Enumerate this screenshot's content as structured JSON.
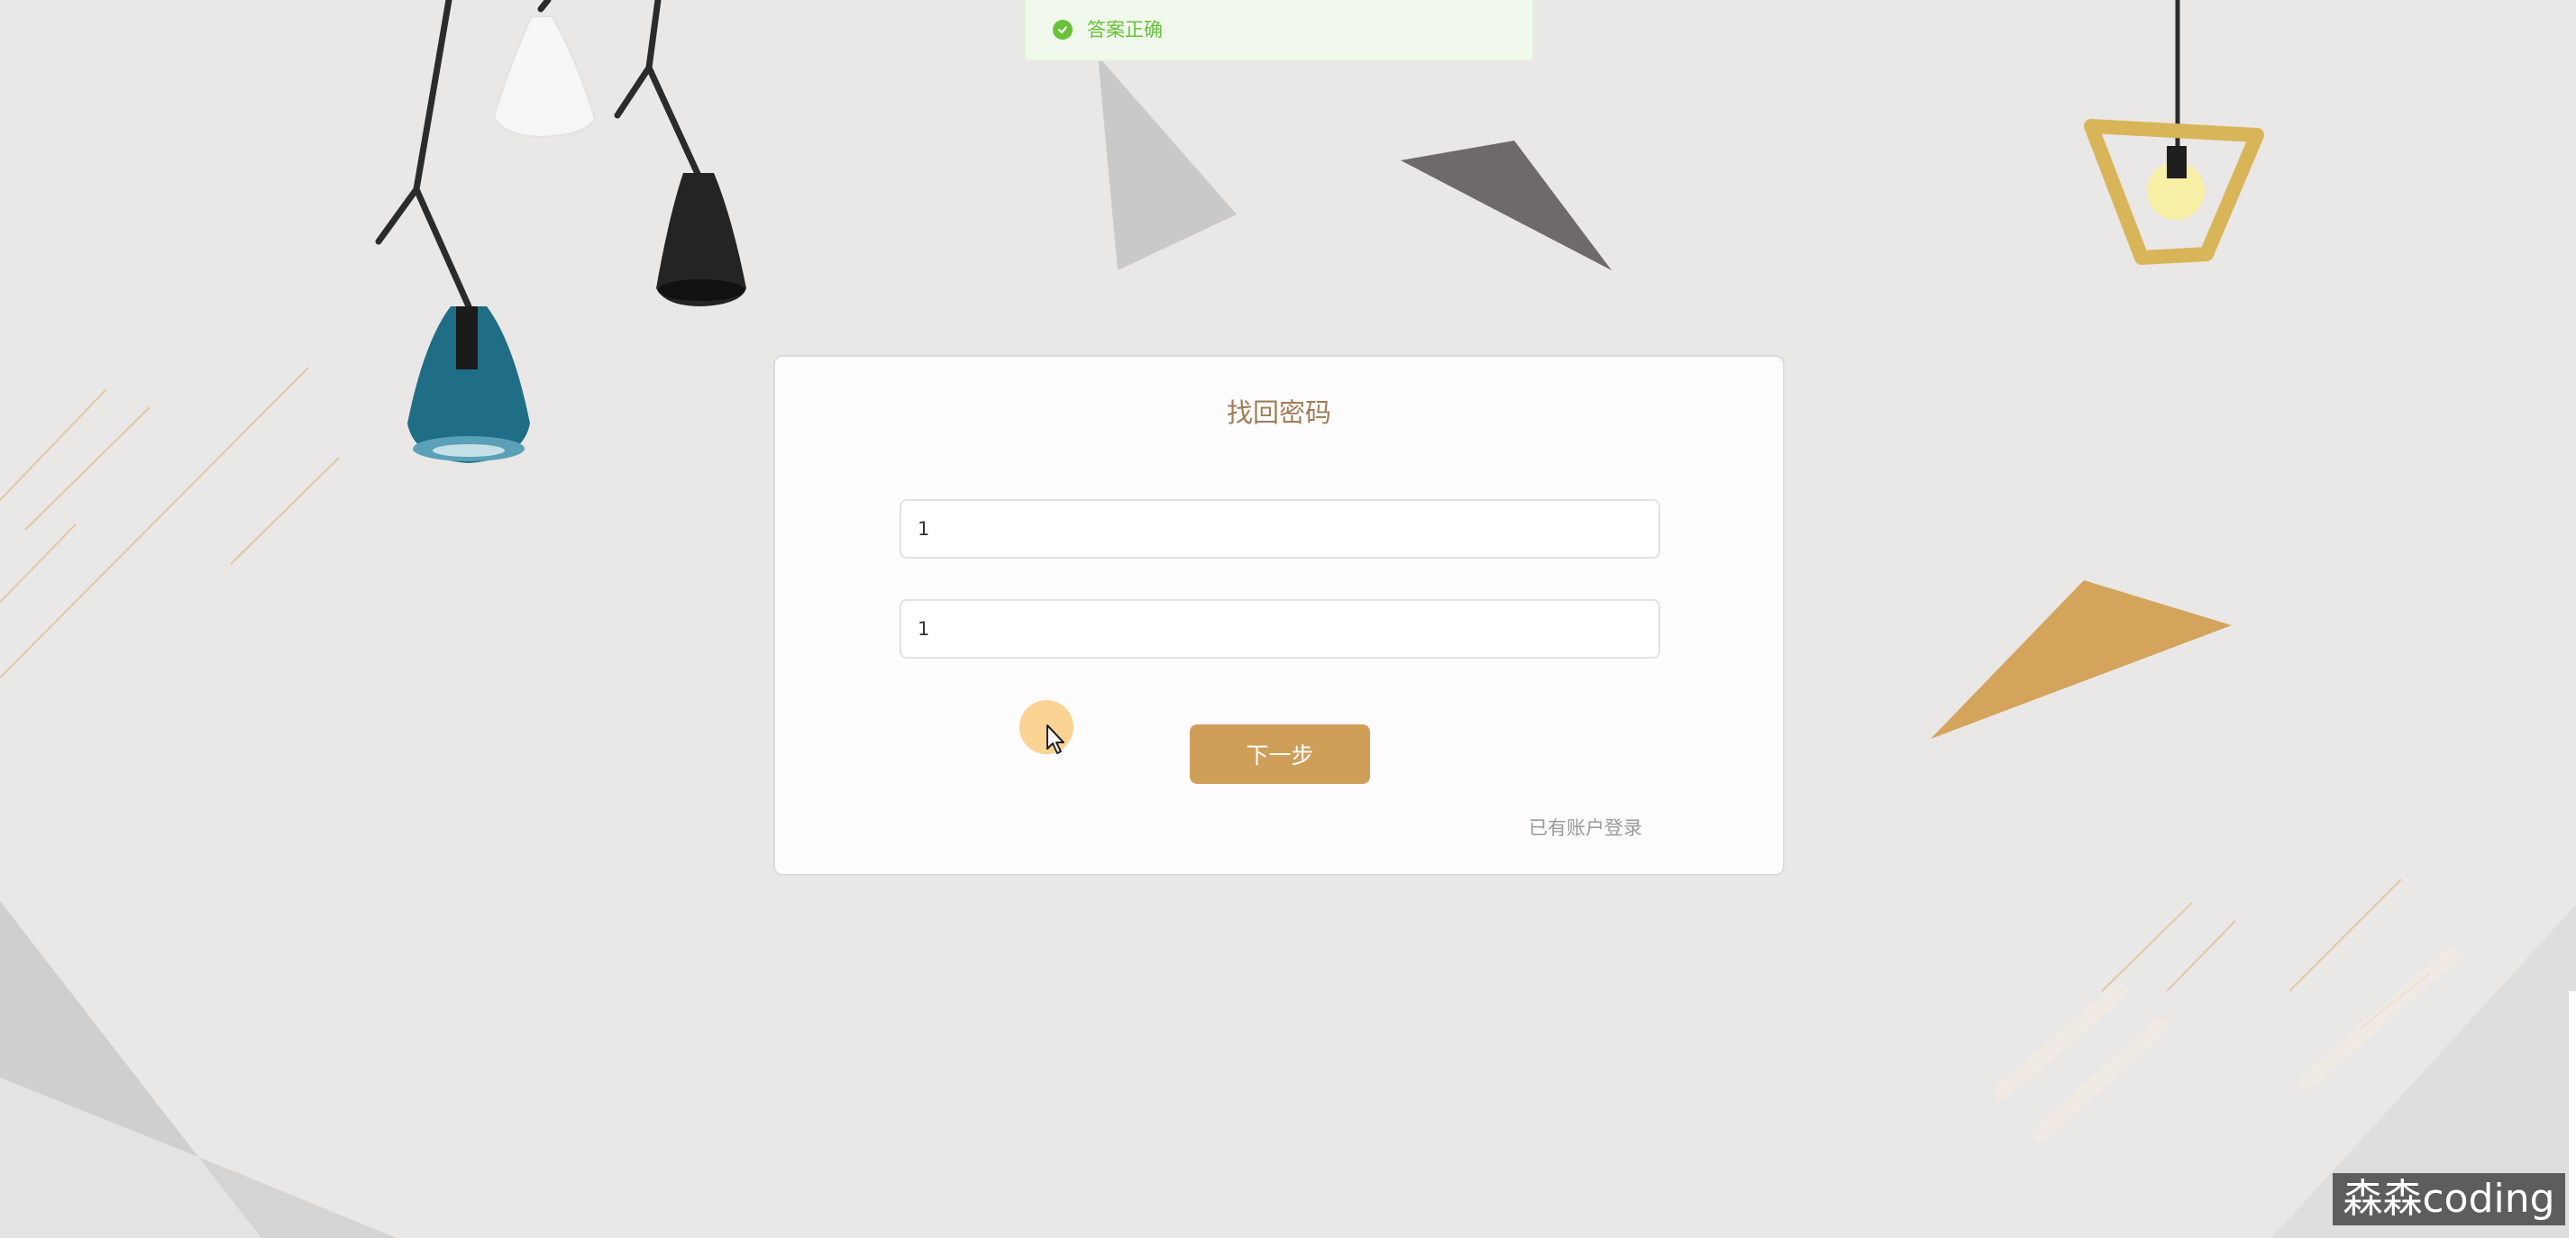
{
  "toast": {
    "message": "答案正确",
    "type": "success",
    "color": "#67c23a"
  },
  "card": {
    "title": "找回密码",
    "fields": [
      {
        "value": "1"
      },
      {
        "value": "1"
      }
    ],
    "next_button_label": "下一步",
    "login_link_label": "已有账户登录"
  },
  "colors": {
    "accent": "#cf9f5a",
    "title": "#a07e56",
    "background": "#e9e8e6"
  },
  "icons": {
    "toast_icon": "check-circle-icon"
  },
  "watermark": {
    "text": "森森coding"
  }
}
